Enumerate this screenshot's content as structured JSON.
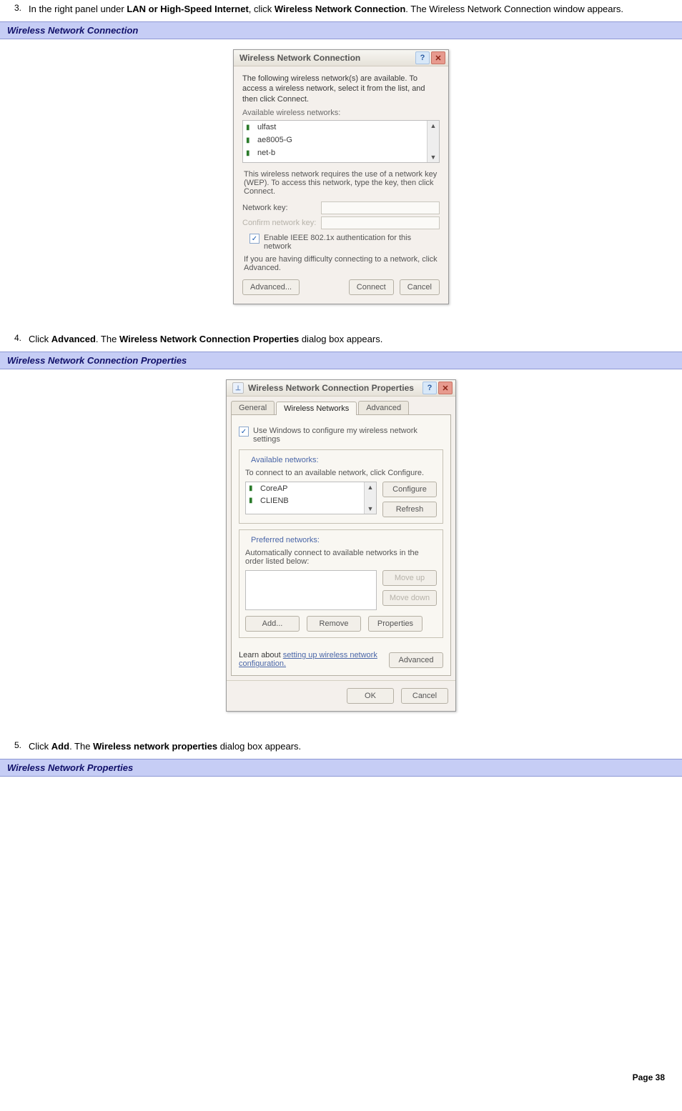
{
  "steps": {
    "s3": {
      "num": "3.",
      "text_pre": "In the right panel under ",
      "b1": "LAN or High-Speed Internet",
      "mid1": ", click ",
      "b2": "Wireless Network Connection",
      "text_post": ". The Wireless Network Connection window appears."
    },
    "s4": {
      "num": "4.",
      "pre": "Click ",
      "b1": "Advanced",
      "mid": ". The ",
      "b2": "Wireless Network Connection Properties",
      "post": " dialog box appears."
    },
    "s5": {
      "num": "5.",
      "pre": "Click ",
      "b1": "Add",
      "mid": ". The ",
      "b2": "Wireless network properties",
      "post": " dialog box appears."
    }
  },
  "banners": {
    "b1": "Wireless Network Connection",
    "b2": "Wireless Network Connection Properties",
    "b3": "Wireless Network Properties"
  },
  "dlg1": {
    "title": "Wireless Network Connection",
    "intro": "The following wireless network(s) are available. To access a wireless network, select it from the list, and then click Connect.",
    "avail_label": "Available wireless networks:",
    "networks": [
      "ulfast",
      "ae8005-G",
      "net-b"
    ],
    "wep_note": "This wireless network requires the use of a network key (WEP). To access this network, type the key, then click Connect.",
    "key_label": "Network key:",
    "confirm_label": "Confirm network key:",
    "ieee_label": "Enable IEEE 802.1x authentication for this network",
    "adv_hint": "If you are having difficulty connecting to a network, click Advanced.",
    "btn_adv": "Advanced...",
    "btn_connect": "Connect",
    "btn_cancel": "Cancel"
  },
  "dlg2": {
    "title": "Wireless Network Connection Properties",
    "tabs": {
      "general": "General",
      "wireless": "Wireless Networks",
      "advanced": "Advanced"
    },
    "use_windows": "Use Windows to configure my wireless network settings",
    "avail": {
      "legend": "Available networks:",
      "text": "To connect to an available network, click Configure.",
      "items": [
        "CoreAP",
        "CLIENB"
      ],
      "btn_cfg": "Configure",
      "btn_ref": "Refresh"
    },
    "pref": {
      "legend": "Preferred networks:",
      "text": "Automatically connect to available networks in the order listed below:",
      "btn_up": "Move up",
      "btn_down": "Move down",
      "btn_add": "Add...",
      "btn_remove": "Remove",
      "btn_props": "Properties"
    },
    "learn_pre": "Learn about ",
    "learn_link": "setting up wireless network configuration.",
    "btn_adv": "Advanced",
    "btn_ok": "OK",
    "btn_cancel": "Cancel"
  },
  "footer": "Page 38"
}
